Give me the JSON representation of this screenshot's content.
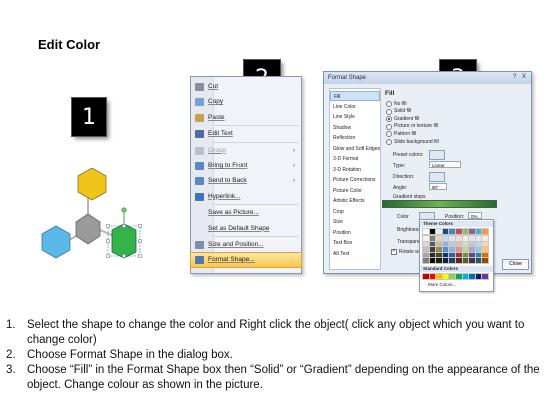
{
  "title": "Edit Color",
  "step_numbers": [
    "1",
    "2",
    "3"
  ],
  "context_menu": {
    "items": [
      {
        "label": "Cut",
        "icon": "scissors-icon",
        "disabled": false,
        "submenu": false,
        "highlighted": false,
        "color": "#8a8fa0"
      },
      {
        "label": "Copy",
        "icon": "copy-icon",
        "disabled": false,
        "submenu": false,
        "highlighted": false,
        "color": "#7aa0d0"
      },
      {
        "label": "Paste",
        "icon": "paste-icon",
        "disabled": false,
        "submenu": false,
        "highlighted": false,
        "color": "#c8a050"
      },
      {
        "label": "Edit Text",
        "icon": "edit-text-icon",
        "disabled": false,
        "submenu": false,
        "highlighted": false,
        "color": "#4a6aa8"
      },
      {
        "label": "Group",
        "icon": "group-icon",
        "disabled": true,
        "submenu": true,
        "highlighted": false,
        "color": "#b8c0cc"
      },
      {
        "label": "Bring to Front",
        "icon": "bring-front-icon",
        "disabled": false,
        "submenu": true,
        "highlighted": false,
        "color": "#5d86c4"
      },
      {
        "label": "Send to Back",
        "icon": "send-back-icon",
        "disabled": false,
        "submenu": true,
        "highlighted": false,
        "color": "#5d86c4"
      },
      {
        "label": "Hyperlink...",
        "icon": "hyperlink-icon",
        "disabled": false,
        "submenu": false,
        "highlighted": false,
        "color": "#3f72b8"
      },
      {
        "label": "Save as Picture...",
        "icon": "",
        "disabled": false,
        "submenu": false,
        "highlighted": false,
        "color": ""
      },
      {
        "label": "Set as Default Shape",
        "icon": "",
        "disabled": false,
        "submenu": false,
        "highlighted": false,
        "color": ""
      },
      {
        "label": "Size and Position...",
        "icon": "size-position-icon",
        "disabled": false,
        "submenu": false,
        "highlighted": false,
        "color": "#7c8fb0"
      },
      {
        "label": "Format Shape...",
        "icon": "format-shape-icon",
        "disabled": false,
        "submenu": false,
        "highlighted": true,
        "color": "#5577aa"
      }
    ]
  },
  "format_shape": {
    "title": "Format Shape",
    "window_buttons": "? X",
    "nav_items": [
      "Fill",
      "Line Color",
      "Line Style",
      "Shadow",
      "Reflection",
      "Glow and Soft Edges",
      "3-D Format",
      "3-D Rotation",
      "Picture Corrections",
      "Picture Color",
      "Artistic Effects",
      "Crop",
      "Size",
      "Position",
      "Text Box",
      "Alt Text"
    ],
    "selected_nav": "Fill",
    "section_heading": "Fill",
    "fill_options": [
      {
        "label": "No fill",
        "selected": false
      },
      {
        "label": "Solid fill",
        "selected": false
      },
      {
        "label": "Gradient fill",
        "selected": true
      },
      {
        "label": "Picture or texture fill",
        "selected": false
      },
      {
        "label": "Pattern fill",
        "selected": false
      },
      {
        "label": "Slide background fill",
        "selected": false
      }
    ],
    "preset_colors_label": "Preset colors:",
    "type_label": "Type:",
    "type_value": "Linear",
    "direction_label": "Direction:",
    "angle_label": "Angle:",
    "angle_value": "90°",
    "gradient_stops_label": "Gradient stops",
    "color_label": "Color",
    "position_label": "Position:",
    "position_value": "0%",
    "brightness_label": "Brightness:",
    "transparency_label": "Transparency:",
    "rotate_label": "Rotate with shape",
    "rotate_checked": true,
    "close_label": "Close"
  },
  "color_palette": {
    "theme_label": "Theme Colors",
    "standard_label": "Standard Colors",
    "more_label": "More Colors...",
    "theme_top": [
      "#ffffff",
      "#000000",
      "#eeece1",
      "#1f497d",
      "#4f81bd",
      "#c0504d",
      "#9bbb59",
      "#8064a2",
      "#4bacc6",
      "#f79646"
    ],
    "theme_shades": [
      [
        "#f2f2f2",
        "#7f7f7f",
        "#ddd9c3",
        "#c6d9f0",
        "#dbe5f1",
        "#f2dcdb",
        "#ebf1dd",
        "#e5e0ec",
        "#dbeef3",
        "#fdeada"
      ],
      [
        "#d8d8d8",
        "#595959",
        "#c4bd97",
        "#8db3e2",
        "#b8cce4",
        "#e5b9b7",
        "#d7e3bc",
        "#ccc1d9",
        "#b7dde8",
        "#fbd5b5"
      ],
      [
        "#bfbfbf",
        "#3f3f3f",
        "#938953",
        "#548dd4",
        "#95b3d7",
        "#d99694",
        "#c3d69b",
        "#b2a2c7",
        "#92cddc",
        "#fac08f"
      ],
      [
        "#a5a5a5",
        "#262626",
        "#494429",
        "#17365d",
        "#366092",
        "#953734",
        "#76923c",
        "#5f497a",
        "#31859b",
        "#e36c09"
      ],
      [
        "#7f7f7f",
        "#0c0c0c",
        "#1d1b10",
        "#0f243e",
        "#244061",
        "#632423",
        "#4f6128",
        "#3f3151",
        "#205867",
        "#974806"
      ]
    ],
    "standard": [
      "#c00000",
      "#ff0000",
      "#ffc000",
      "#ffff00",
      "#92d050",
      "#00b050",
      "#00b0f0",
      "#0070c0",
      "#002060",
      "#7030a0"
    ]
  },
  "shapes": {
    "top_color": "#f0c419",
    "left_color": "#5cb8e8",
    "center_color": "#9a9a9a",
    "selected_color": "#35b34a"
  },
  "instructions": [
    {
      "num": "1.",
      "text": "Select the shape to change the color and Right click the object( click any object which you want to change color)"
    },
    {
      "num": "2.",
      "text": "Choose Format Shape in the dialog box."
    },
    {
      "num": "3.",
      "text": "Choose “Fill” in the Format Shape box then “Solid” or “Gradient” depending on the appearance of the object. Change colour as shown in the picture."
    }
  ]
}
